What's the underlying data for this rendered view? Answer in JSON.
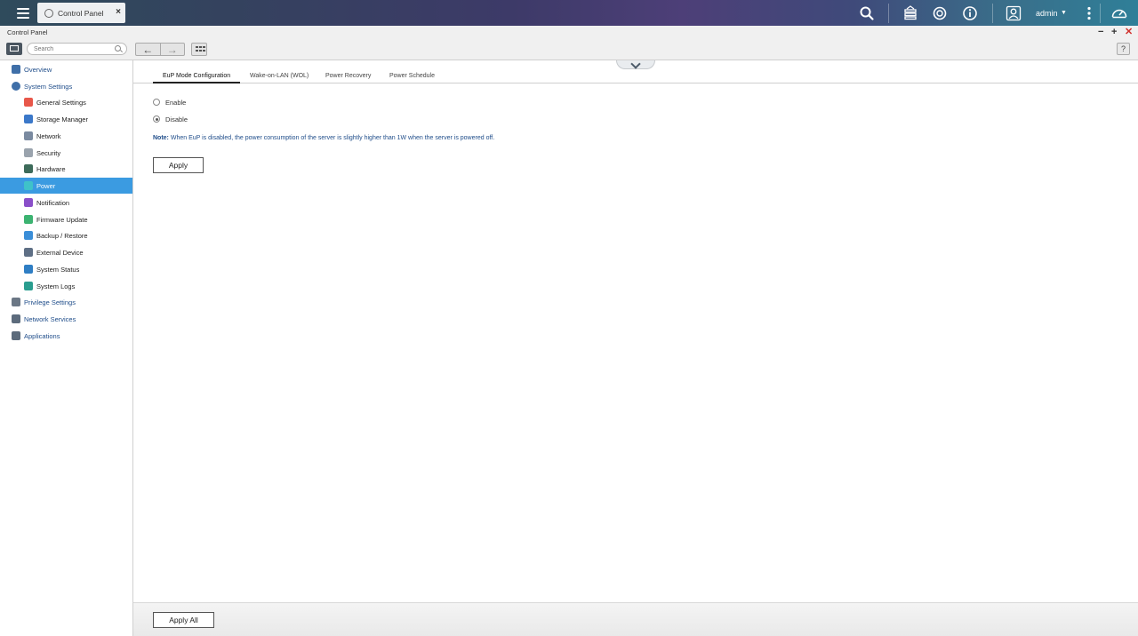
{
  "taskbar": {
    "app_tab_label": "Control Panel",
    "user": "admin"
  },
  "window": {
    "title": "Control Panel"
  },
  "toolbar": {
    "search_placeholder": "Search",
    "help": "?"
  },
  "sidebar": {
    "items": [
      {
        "label": "Overview",
        "icon": "grid-icon",
        "level": "top",
        "color": "#3f6fa8"
      },
      {
        "label": "System Settings",
        "icon": "gear-icon",
        "level": "top",
        "color": "#3f6fa8"
      },
      {
        "label": "General Settings",
        "icon": "general-settings-icon",
        "level": "sub",
        "color": "#e8574a"
      },
      {
        "label": "Storage Manager",
        "icon": "storage-icon",
        "level": "sub",
        "color": "#3b78c9"
      },
      {
        "label": "Network",
        "icon": "network-icon",
        "level": "sub",
        "color": "#7a8aa0"
      },
      {
        "label": "Security",
        "icon": "lock-icon",
        "level": "sub",
        "color": "#9aa3ad"
      },
      {
        "label": "Hardware",
        "icon": "hardware-icon",
        "level": "sub",
        "color": "#3d6b5a"
      },
      {
        "label": "Power",
        "icon": "power-icon",
        "level": "sub",
        "color": "#3fc2c9",
        "active": true
      },
      {
        "label": "Notification",
        "icon": "notification-icon",
        "level": "sub",
        "color": "#8a4fc9"
      },
      {
        "label": "Firmware Update",
        "icon": "firmware-icon",
        "level": "sub",
        "color": "#3cb371"
      },
      {
        "label": "Backup / Restore",
        "icon": "backup-icon",
        "level": "sub",
        "color": "#3b8ed8"
      },
      {
        "label": "External Device",
        "icon": "external-device-icon",
        "level": "sub",
        "color": "#5e6f85"
      },
      {
        "label": "System Status",
        "icon": "system-status-icon",
        "level": "sub",
        "color": "#2f7ec4"
      },
      {
        "label": "System Logs",
        "icon": "system-logs-icon",
        "level": "sub",
        "color": "#2a9d8f"
      },
      {
        "label": "Privilege Settings",
        "icon": "user-icon",
        "level": "top",
        "color": "#6b7785"
      },
      {
        "label": "Network Services",
        "icon": "network-services-icon",
        "level": "top",
        "color": "#5c6b7c"
      },
      {
        "label": "Applications",
        "icon": "applications-icon",
        "level": "top",
        "color": "#5c6b7c"
      }
    ]
  },
  "tabs": [
    {
      "label": "EuP Mode Configuration",
      "active": true
    },
    {
      "label": "Wake-on-LAN (WOL)"
    },
    {
      "label": "Power Recovery"
    },
    {
      "label": "Power Schedule"
    }
  ],
  "eup": {
    "options": [
      {
        "label": "Enable",
        "checked": false
      },
      {
        "label": "Disable",
        "checked": true
      }
    ],
    "note_prefix": "Note:",
    "note_text": "When EuP is disabled, the power consumption of the server is slightly higher than 1W when the server is powered off.",
    "apply_label": "Apply"
  },
  "footer": {
    "apply_all_label": "Apply All"
  },
  "colors": {
    "accent": "#3b9be1",
    "link": "#1f4d8a"
  }
}
